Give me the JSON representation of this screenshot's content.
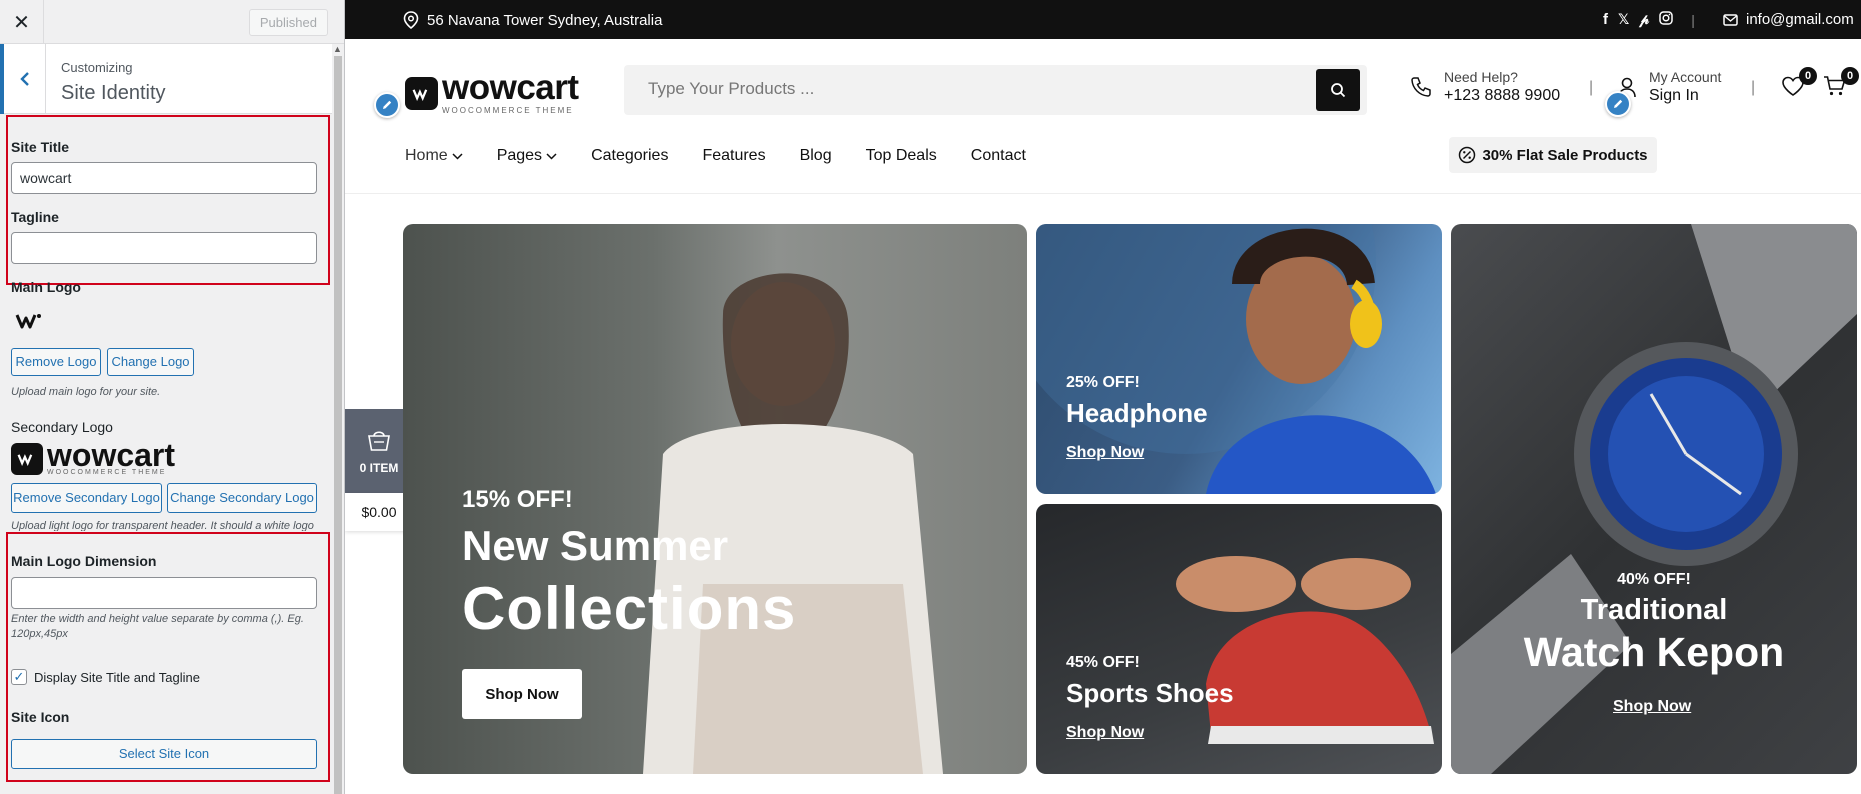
{
  "customizer": {
    "close_label": "✕",
    "publish_label": "Published",
    "header_sub": "Customizing",
    "header_title": "Site Identity",
    "site_title_label": "Site Title",
    "site_title_value": "wowcart",
    "tagline_label": "Tagline",
    "tagline_value": "",
    "main_logo_label": "Main Logo",
    "remove_logo": "Remove Logo",
    "change_logo": "Change Logo",
    "main_logo_help": "Upload main logo for your site.",
    "secondary_logo_label": "Secondary Logo",
    "remove_secondary": "Remove Secondary Logo",
    "change_secondary": "Change Secondary Logo",
    "secondary_help": "Upload light logo for transparent header. It should a white logo",
    "dimension_label": "Main Logo Dimension",
    "dimension_value": "",
    "dimension_help": "Enter the width and height value separate by comma (,). Eg. 120px,45px",
    "display_title_label": "Display Site Title and Tagline",
    "display_title_checked": true,
    "site_icon_label": "Site Icon",
    "select_icon": "Select Site Icon"
  },
  "brand": {
    "name": "wowcart",
    "tagline": "WOOCOMMERCE THEME"
  },
  "topbar": {
    "address": "56 Navana Tower Sydney, Australia",
    "email": "info@gmail.com",
    "socials": [
      "facebook-icon",
      "x-icon",
      "pinterest-icon",
      "instagram-icon"
    ]
  },
  "header": {
    "search_placeholder": "Type Your Products ...",
    "help_small": "Need Help?",
    "help_phone": "+123 8888 9900",
    "account_small": "My Account",
    "account_big": "Sign In",
    "wishlist_count": "0",
    "cart_count": "0"
  },
  "nav": {
    "items": [
      "Home",
      "Pages",
      "Categories",
      "Features",
      "Blog",
      "Top Deals",
      "Contact"
    ],
    "sale": "30% Flat Sale Products"
  },
  "mini_cart": {
    "items": "0 ITEM",
    "total": "$0.00"
  },
  "banners": {
    "main": {
      "discount": "15% OFF!",
      "line1": "New Summer",
      "line2": "Collections",
      "cta": "Shop Now"
    },
    "headphone": {
      "discount": "25% OFF!",
      "title": "Headphone",
      "cta": "Shop Now"
    },
    "shoes": {
      "discount": "45% OFF!",
      "title": "Sports Shoes",
      "cta": "Shop Now"
    },
    "watch": {
      "discount": "40% OFF!",
      "line1": "Traditional",
      "line2": "Watch Kepon",
      "cta": "Shop Now"
    }
  },
  "colors": {
    "accent": "#2271b1",
    "highlight": "#d0021b",
    "dark": "#111111"
  }
}
